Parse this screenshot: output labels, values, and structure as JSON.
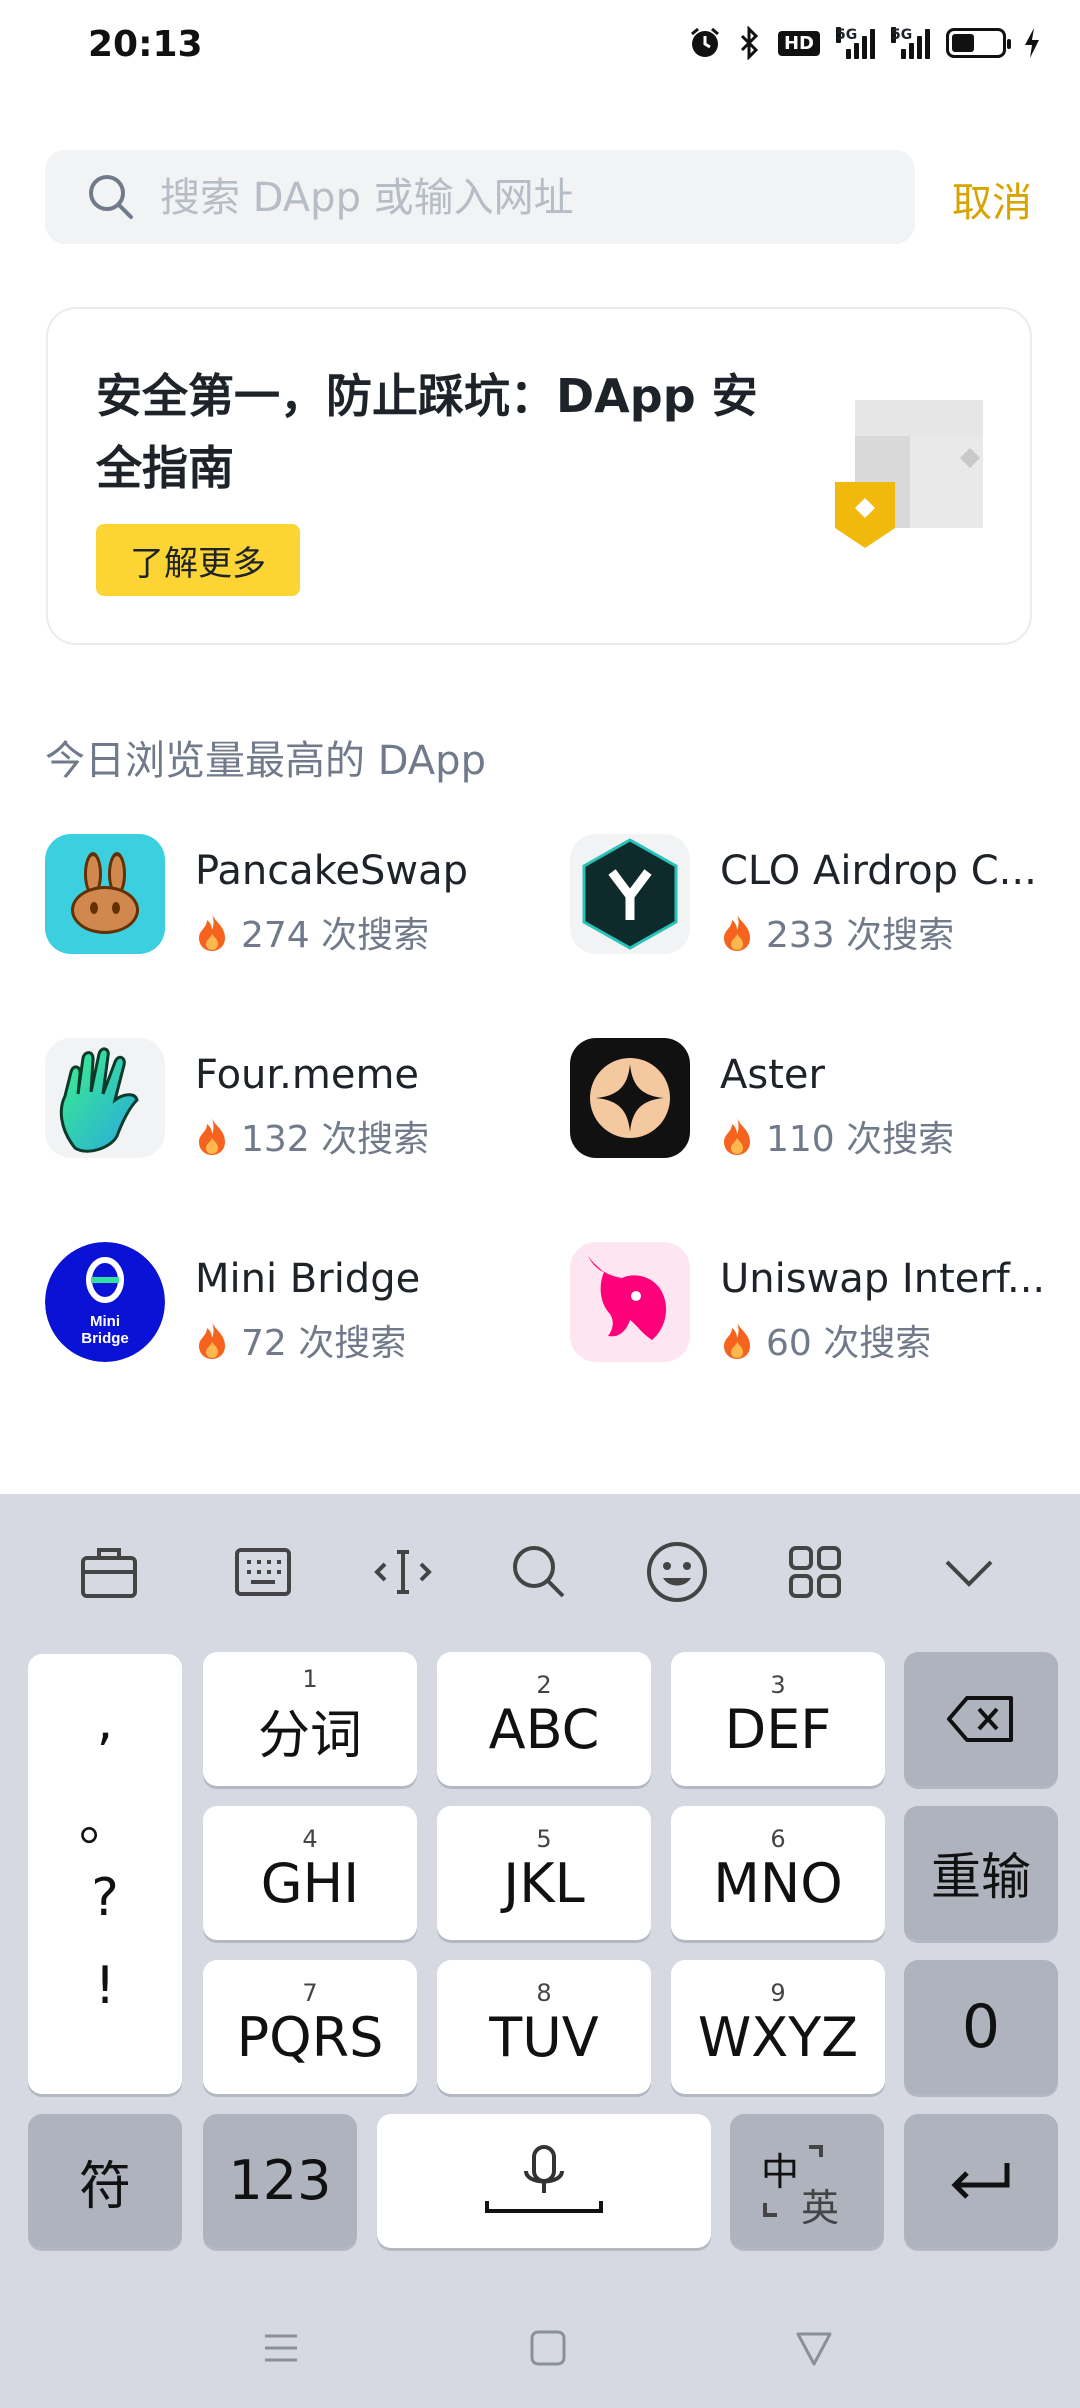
{
  "status_bar": {
    "time": "20:13",
    "network_1": "5G",
    "network_2": "5G",
    "hd_label": "HD",
    "battery_percent": 45
  },
  "search": {
    "placeholder": "搜索 DApp 或输入网址",
    "value": "",
    "cancel_label": "取消"
  },
  "banner": {
    "title": "安全第一，防止踩坑：DApp 安全指南",
    "button_label": "了解更多"
  },
  "top_dapps": {
    "section_title": "今日浏览量最高的 DApp",
    "items": [
      {
        "name": "PancakeSwap",
        "count": "274 次搜索",
        "icon": "pancakeswap-logo"
      },
      {
        "name": "CLO Airdrop C...",
        "count": "233 次搜索",
        "icon": "clo-airdrop-logo"
      },
      {
        "name": "Four.meme",
        "count": "132 次搜索",
        "icon": "four-meme-logo"
      },
      {
        "name": "Aster",
        "count": "110 次搜索",
        "icon": "aster-logo"
      },
      {
        "name": "Mini Bridge",
        "count": "72 次搜索",
        "icon": "mini-bridge-logo",
        "logo_text": "Mini Bridge"
      },
      {
        "name": "Uniswap Interf...",
        "count": "60 次搜索",
        "icon": "uniswap-logo"
      }
    ]
  },
  "keyboard": {
    "toolbar": [
      "toolbox-icon",
      "keyboard-icon",
      "cursor-icon",
      "search-icon",
      "emoji-icon",
      "grid-icon",
      "chevron-down-icon"
    ],
    "punctuation": [
      ",",
      "。",
      "?",
      "!"
    ],
    "keys": {
      "k1": {
        "num": "1",
        "label": "分词"
      },
      "k2": {
        "num": "2",
        "label": "ABC"
      },
      "k3": {
        "num": "3",
        "label": "DEF"
      },
      "k4": {
        "num": "4",
        "label": "GHI"
      },
      "k5": {
        "num": "5",
        "label": "JKL"
      },
      "k6": {
        "num": "6",
        "label": "MNO"
      },
      "k7": {
        "num": "7",
        "label": "PQRS"
      },
      "k8": {
        "num": "8",
        "label": "TUV"
      },
      "k9": {
        "num": "9",
        "label": "WXYZ"
      },
      "reset": "重输",
      "zero": "0",
      "symbols": "符",
      "numbers": "123",
      "lang_zh": "中",
      "lang_en": "英"
    }
  },
  "colors": {
    "accent": "#fcd535",
    "cancel": "#d9a300",
    "keyboard_bg": "#d6d9e2"
  }
}
